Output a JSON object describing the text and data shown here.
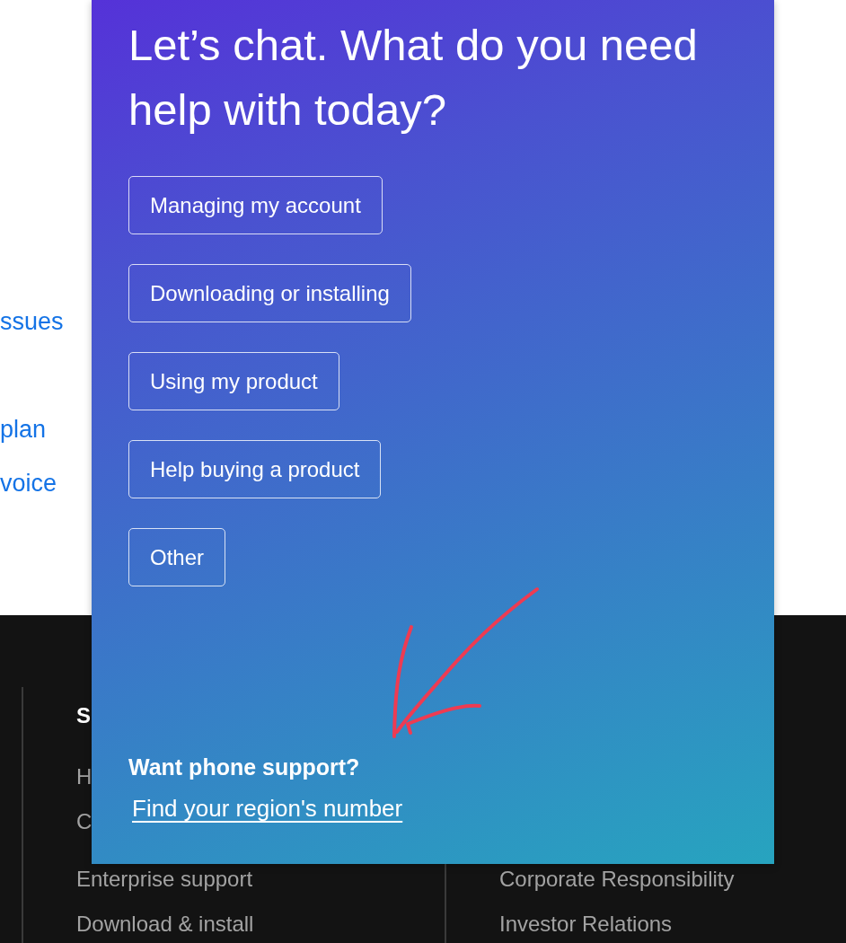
{
  "background_page": {
    "links": [
      "ssues",
      "plan",
      "voice"
    ]
  },
  "footer": {
    "column_1": {
      "heading": "S",
      "links": [
        "H",
        "C",
        "Enterprise support",
        "Download & install"
      ]
    },
    "column_2": {
      "links": [
        "Corporate Responsibility",
        "Investor Relations"
      ]
    }
  },
  "chat_panel": {
    "title": "Let’s chat. What do you need help with today?",
    "options": [
      "Managing my account",
      "Downloading or installing",
      "Using my product",
      "Help buying a product",
      "Other"
    ],
    "phone_heading": "Want phone support?",
    "phone_link": "Find your region's number"
  }
}
